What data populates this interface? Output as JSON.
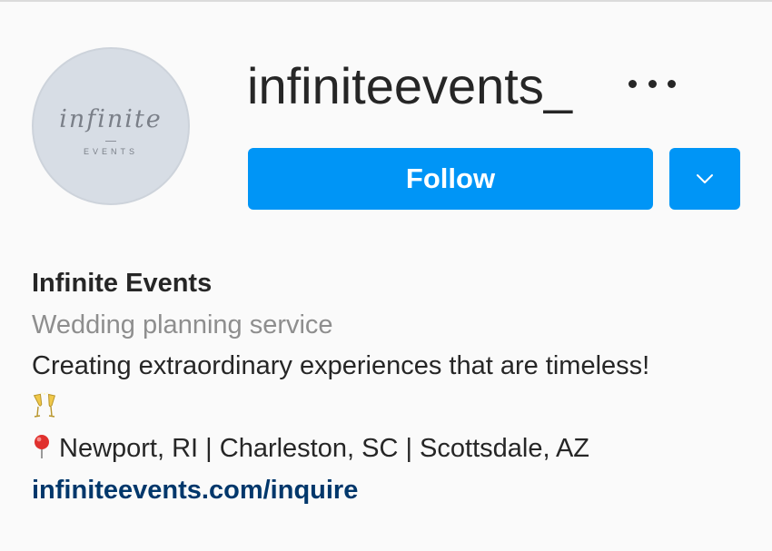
{
  "profile": {
    "username": "infiniteevents_",
    "avatar": {
      "script_text": "infinite",
      "sub_text": "EVENTS"
    },
    "follow_label": "Follow",
    "more_icon": "more-options-icon",
    "dropdown_icon": "chevron-down-icon"
  },
  "bio": {
    "name": "Infinite Events",
    "category": "Wedding planning service",
    "description": "Creating extraordinary experiences that are timeless!",
    "emoji_icon": "clinking-glasses-icon",
    "location_icon": "round-pushpin-icon",
    "locations": "Newport, RI | Charleston, SC | Scottsdale, AZ",
    "link": "infiniteevents.com/inquire"
  },
  "colors": {
    "primary_button": "#0095f6",
    "link": "#00376b",
    "secondary_text": "#8e8e8e",
    "text": "#262626"
  }
}
